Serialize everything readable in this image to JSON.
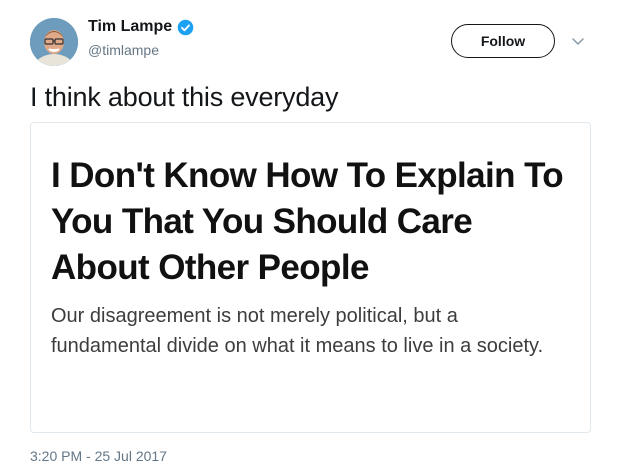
{
  "author": {
    "name": "Tim Lampe",
    "handle": "@timlampe",
    "verified": true,
    "avatar_icon": "profile-photo"
  },
  "header": {
    "follow_label": "Follow",
    "menu_icon": "chevron-down-icon"
  },
  "tweet": {
    "text": "I think about this everyday",
    "timestamp": "3:20 PM - 25 Jul 2017"
  },
  "card": {
    "title": "I Don't Know How To Explain To You That You Should Care About Other People",
    "description": "Our disagreement is not merely political, but a fundamental divide on what it means to live in a society."
  },
  "colors": {
    "verified_blue": "#1da1f2",
    "secondary_text": "#657786",
    "card_border": "#e1e8ed"
  }
}
